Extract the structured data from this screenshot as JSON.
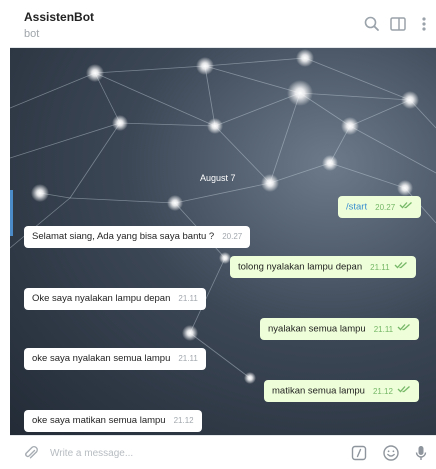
{
  "header": {
    "title": "AssistenBot",
    "subtitle": "bot"
  },
  "chat": {
    "date": "August 7",
    "messages": [
      {
        "dir": "out",
        "text": "/start",
        "time": "20.27",
        "read": true
      },
      {
        "dir": "in",
        "text": "Selamat siang, Ada yang bisa saya bantu ?",
        "time": "20.27"
      },
      {
        "dir": "out",
        "text": "tolong nyalakan lampu depan",
        "time": "21.11",
        "read": true
      },
      {
        "dir": "in",
        "text": "Oke saya nyalakan lampu depan",
        "time": "21.11"
      },
      {
        "dir": "out",
        "text": "nyalakan semua lampu",
        "time": "21.11",
        "read": true
      },
      {
        "dir": "in",
        "text": "oke saya nyalakan semua lampu",
        "time": "21.11"
      },
      {
        "dir": "out",
        "text": "matikan semua lampu",
        "time": "21.12",
        "read": true
      },
      {
        "dir": "in",
        "text": "oke saya matikan semua lampu",
        "time": "21.12"
      }
    ]
  },
  "composer": {
    "placeholder": "Write a message..."
  },
  "colors": {
    "accent": "#4b8cc8",
    "outgoing_bubble": "#eefed8",
    "incoming_bubble": "#ffffff",
    "check": "#76b868",
    "command_link": "#3a8fd1"
  },
  "icons": [
    "search-icon",
    "sidebar-toggle-icon",
    "more-vert-icon",
    "paperclip-icon",
    "bot-commands-icon",
    "emoji-icon",
    "microphone-icon",
    "double-check-icon"
  ]
}
